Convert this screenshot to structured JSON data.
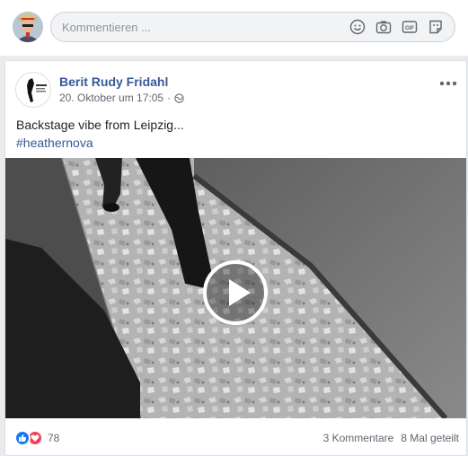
{
  "composer": {
    "placeholder": "Kommentieren ...",
    "icons": [
      "smiley-icon",
      "camera-icon",
      "gif-icon",
      "sticker-icon"
    ]
  },
  "post": {
    "author": "Berit Rudy Fridahl",
    "timestamp": "20. Oktober um 17:05",
    "privacy_icon": "globe-icon",
    "text": "Backstage vibe from Leipzig...",
    "hashtag": "#heathernova",
    "video": {
      "play_icon": "play-icon",
      "description": "Black-and-white hallway footage"
    },
    "reactions": {
      "types": [
        "like",
        "love"
      ],
      "count": "78"
    },
    "comments_label": "3 Kommentare",
    "shares_label": "8 Mal geteilt"
  },
  "colors": {
    "link_blue": "#365899",
    "background": "#e9ebee",
    "like_blue": "#1877f2",
    "love_red": "#f33e58"
  }
}
